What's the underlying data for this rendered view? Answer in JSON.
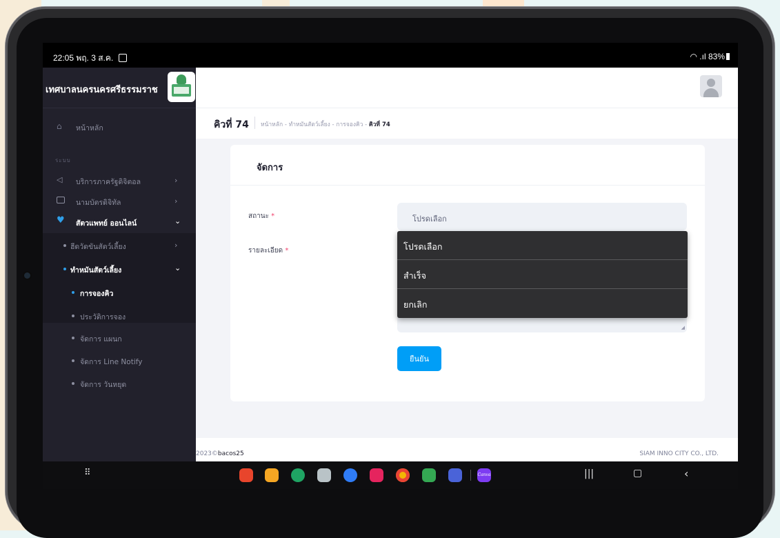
{
  "status_bar": {
    "time": "22:05",
    "date": "พฤ. 3 ส.ค.",
    "battery": "83%"
  },
  "sidebar": {
    "brand_title": "เทศบาลนครนครศรีธรรมราช",
    "home_label": "หน้าหลัก",
    "section_label": "ระบบ",
    "items": [
      {
        "label": "บริการภาครัฐดิจิตอล",
        "icon": "megaphone-icon"
      },
      {
        "label": "นามบัตรดิจิทัล",
        "icon": "id-card-icon"
      },
      {
        "label": "สัตวแพทย์ ออนไลน์",
        "icon": "heart-pulse-icon"
      }
    ],
    "sub_items": [
      {
        "label": "ฮีดวัดขันสัตว์เลี้ยง"
      },
      {
        "label": "ทำหมันสัตว์เลี้ยง"
      }
    ],
    "leaf_items": [
      {
        "label": "การจองคิว"
      },
      {
        "label": "ประวัติการจอง"
      },
      {
        "label": "จัดการ แผนก"
      },
      {
        "label": "จัดการ Line Notify"
      },
      {
        "label": "จัดการ วันหยุด"
      }
    ]
  },
  "toolbar": {
    "page_title": "คิวที่ 74",
    "breadcrumb": [
      "หน้าหลัก",
      "ทำหมันสัตว์เลี้ยง",
      "การจองคิว",
      "คิวที่ 74"
    ],
    "bc_sep": "-"
  },
  "form": {
    "card_title": "จัดการ",
    "status_label": "สถานะ",
    "detail_label": "รายละเอียด",
    "required_mark": "*",
    "status_value": "โปรดเลือก",
    "confirm_label": "ยืนยัน"
  },
  "dropdown": {
    "options": [
      "โปรดเลือก",
      "สำเร็จ",
      "ยกเลิก"
    ]
  },
  "footer": {
    "year": "2023©",
    "author": "bacos25",
    "company": "SIAM INNO CITY CO., LTD."
  },
  "app_bar": {
    "canva_label": "Canva"
  },
  "colors": {
    "accent": "#009ef7",
    "sidebar_bg": "#22212c",
    "required": "#f1416c"
  }
}
